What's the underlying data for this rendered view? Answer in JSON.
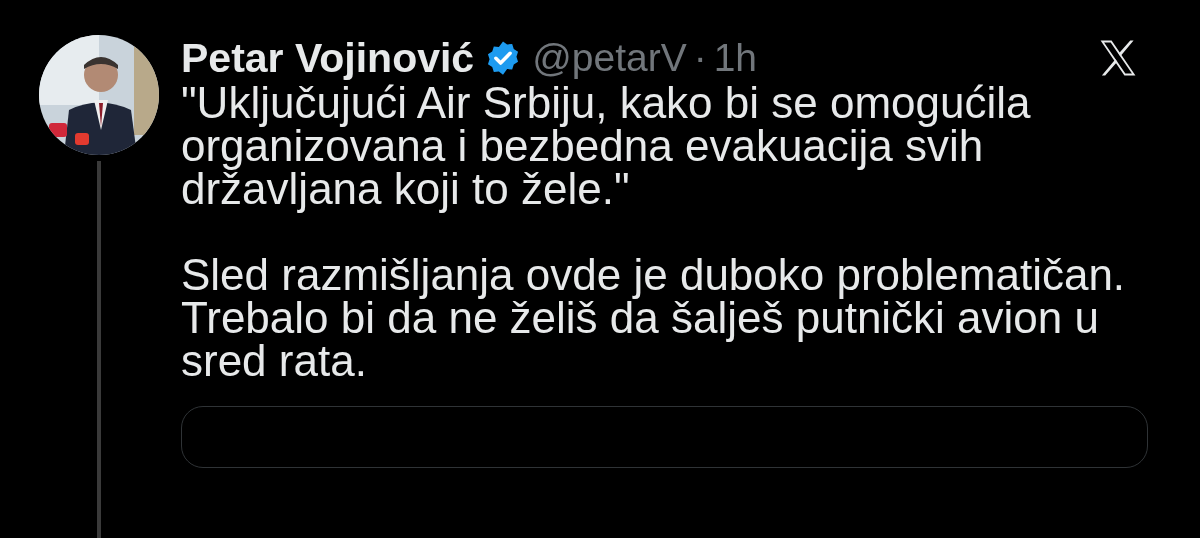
{
  "author": {
    "name": "Petar Vojinović",
    "verified": true,
    "handle": "@petarV",
    "separator": "·",
    "time": "1h"
  },
  "paragraphs": [
    "\"Uključujući Air Srbiju, kako bi se omogućila organizovana i bezbedna evakuacija svih državljana koji to žele.\"",
    "Sled razmišljanja ovde je duboko problematičan. Trebalo bi da ne želiš da šalješ putnički avion u sred rata."
  ],
  "quoted_card": true
}
